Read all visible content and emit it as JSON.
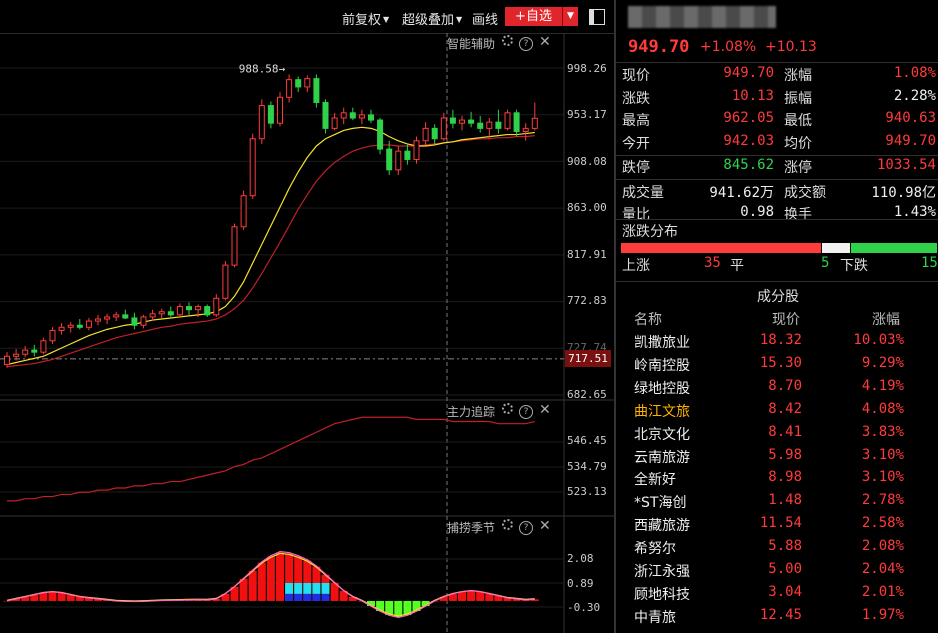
{
  "toolbar": {
    "items": [
      "前复权",
      "超级叠加",
      "画线"
    ],
    "add_fav": "+自选"
  },
  "panels": {
    "main_title": "智能辅助",
    "sub1_title": "主力追踪",
    "sub2_title": "捕捞季节"
  },
  "axis": {
    "main": [
      "998.26",
      "953.17",
      "908.08",
      "863.00",
      "817.91",
      "772.83",
      "727.74",
      "682.65"
    ],
    "price_tag": "717.51",
    "sub1": [
      "546.45",
      "534.79",
      "523.13"
    ],
    "sub2": [
      "2.08",
      "0.89",
      "-0.30"
    ]
  },
  "colors": {
    "up": "#ff3b3b",
    "down": "#2fd24a",
    "ma_fast": "#f5e12a",
    "ma_slow": "#c0202a",
    "brand": "#e0262c"
  },
  "chart_data": {
    "type": "candlestick",
    "peak_label": "988.58→",
    "y_ticks": [
      998.26,
      953.17,
      908.08,
      863.0,
      817.91,
      772.83,
      727.74,
      682.65
    ],
    "current_price_line": 717.51,
    "candles": [
      [
        712,
        724,
        709,
        720
      ],
      [
        720,
        727,
        716,
        722
      ],
      [
        722,
        730,
        719,
        726
      ],
      [
        726,
        731,
        720,
        724
      ],
      [
        724,
        738,
        722,
        735
      ],
      [
        735,
        748,
        732,
        745
      ],
      [
        745,
        752,
        741,
        748
      ],
      [
        748,
        753,
        743,
        750
      ],
      [
        750,
        756,
        746,
        748
      ],
      [
        748,
        757,
        745,
        754
      ],
      [
        754,
        760,
        750,
        756
      ],
      [
        756,
        761,
        751,
        758
      ],
      [
        758,
        763,
        754,
        760
      ],
      [
        760,
        765,
        756,
        757
      ],
      [
        757,
        762,
        746,
        750
      ],
      [
        750,
        760,
        747,
        758
      ],
      [
        758,
        765,
        754,
        761
      ],
      [
        761,
        766,
        757,
        763
      ],
      [
        763,
        768,
        758,
        760
      ],
      [
        760,
        771,
        757,
        768
      ],
      [
        768,
        772,
        760,
        765
      ],
      [
        765,
        770,
        758,
        768
      ],
      [
        768,
        770,
        758,
        760
      ],
      [
        760,
        780,
        758,
        776
      ],
      [
        776,
        812,
        774,
        808
      ],
      [
        808,
        848,
        806,
        845
      ],
      [
        845,
        880,
        842,
        875
      ],
      [
        875,
        935,
        872,
        930
      ],
      [
        930,
        968,
        925,
        962
      ],
      [
        962,
        966,
        940,
        945
      ],
      [
        945,
        975,
        942,
        970
      ],
      [
        970,
        992,
        965,
        987
      ],
      [
        987,
        990,
        975,
        980
      ],
      [
        980,
        991,
        975,
        988
      ],
      [
        988,
        992,
        960,
        965
      ],
      [
        965,
        968,
        935,
        940
      ],
      [
        940,
        955,
        938,
        950
      ],
      [
        950,
        960,
        944,
        955
      ],
      [
        955,
        960,
        948,
        950
      ],
      [
        950,
        958,
        944,
        953
      ],
      [
        953,
        958,
        945,
        948
      ],
      [
        948,
        950,
        915,
        920
      ],
      [
        920,
        928,
        895,
        900
      ],
      [
        900,
        923,
        895,
        918
      ],
      [
        918,
        925,
        905,
        910
      ],
      [
        910,
        932,
        906,
        928
      ],
      [
        928,
        946,
        924,
        940
      ],
      [
        940,
        944,
        925,
        930
      ],
      [
        930,
        955,
        928,
        950
      ],
      [
        950,
        958,
        940,
        945
      ],
      [
        945,
        952,
        938,
        948
      ],
      [
        948,
        956,
        941,
        945
      ],
      [
        945,
        952,
        936,
        940
      ],
      [
        940,
        950,
        930,
        946
      ],
      [
        946,
        958,
        935,
        940
      ],
      [
        940,
        958,
        938,
        955
      ],
      [
        955,
        958,
        932,
        937
      ],
      [
        937,
        945,
        928,
        940
      ],
      [
        940,
        965,
        938,
        949.7
      ]
    ],
    "ma_fast": [
      712,
      714,
      716,
      718,
      720,
      724,
      728,
      732,
      736,
      740,
      743,
      746,
      748,
      750,
      751,
      753,
      755,
      756,
      757,
      758,
      759,
      760,
      761,
      763,
      768,
      778,
      792,
      810,
      828,
      846,
      864,
      882,
      898,
      912,
      923,
      930,
      934,
      938,
      940,
      941,
      940,
      937,
      932,
      928,
      925,
      923,
      923,
      924,
      926,
      927,
      929,
      930,
      931,
      932,
      933,
      934,
      934,
      935,
      936
    ],
    "ma_slow": [
      710,
      711,
      712,
      713,
      715,
      717,
      720,
      723,
      726,
      729,
      732,
      735,
      738,
      740,
      742,
      744,
      746,
      748,
      749,
      751,
      752,
      753,
      754,
      756,
      760,
      766,
      774,
      786,
      800,
      815,
      830,
      846,
      862,
      876,
      889,
      899,
      907,
      913,
      918,
      921,
      923,
      924,
      924,
      923,
      923,
      923,
      924,
      925,
      926,
      927,
      928,
      929,
      930,
      930,
      931,
      931,
      932,
      932,
      933
    ],
    "sub1_line": [
      519,
      519,
      520,
      520,
      521,
      521,
      522,
      522,
      523,
      523,
      524,
      524,
      525,
      525,
      526,
      526,
      527,
      527,
      528,
      528,
      529,
      530,
      531,
      532,
      533,
      535,
      536,
      538,
      539,
      541,
      543,
      545,
      547,
      549,
      551,
      553,
      555,
      556,
      557,
      558,
      558,
      558,
      558,
      558,
      558,
      557,
      557,
      557,
      557,
      556,
      556,
      556,
      556,
      556,
      555,
      555,
      555,
      555,
      556
    ],
    "sub2_values": [
      0.0,
      0.1,
      0.2,
      0.3,
      0.4,
      0.45,
      0.4,
      0.3,
      0.2,
      0.15,
      0.1,
      0.05,
      0.0,
      -0.02,
      -0.03,
      -0.02,
      0.0,
      0.02,
      0.03,
      0.04,
      0.05,
      0.06,
      0.05,
      0.1,
      0.35,
      0.7,
      1.1,
      1.5,
      1.9,
      2.2,
      2.4,
      2.35,
      2.2,
      2.0,
      1.7,
      1.3,
      0.9,
      0.5,
      0.2,
      0.0,
      -0.25,
      -0.5,
      -0.7,
      -0.8,
      -0.7,
      -0.5,
      -0.25,
      0.0,
      0.2,
      0.35,
      0.45,
      0.5,
      0.45,
      0.35,
      0.25,
      0.15,
      0.1,
      0.05,
      0.08
    ]
  },
  "quote": {
    "price": "949.70",
    "chg_pct": "+1.08%",
    "chg_abs": "+10.13",
    "rows": [
      {
        "l": "现价",
        "v": "949.70",
        "vc": "red",
        "l2": "涨幅",
        "v2": "1.08%",
        "v2c": "red"
      },
      {
        "l": "涨跌",
        "v": "10.13",
        "vc": "red",
        "l2": "振幅",
        "v2": "2.28%",
        "v2c": "white"
      },
      {
        "l": "最高",
        "v": "962.05",
        "vc": "red",
        "l2": "最低",
        "v2": "940.63",
        "v2c": "red"
      },
      {
        "l": "今开",
        "v": "942.03",
        "vc": "red",
        "l2": "均价",
        "v2": "949.70",
        "v2c": "red"
      },
      {
        "l": "跌停",
        "v": "845.62",
        "vc": "green",
        "l2": "涨停",
        "v2": "1033.54",
        "v2c": "red"
      },
      {
        "l": "成交量",
        "v": "941.62万",
        "vc": "white",
        "l2": "成交额",
        "v2": "110.98亿",
        "v2c": "white"
      },
      {
        "l": "量比",
        "v": "0.98",
        "vc": "white",
        "l2": "换手",
        "v2": "1.43%",
        "v2c": "white"
      }
    ]
  },
  "distribution": {
    "title": "涨跌分布",
    "up_label": "上涨",
    "up": "35",
    "flat_label": "平",
    "flat": "5",
    "down_label": "下跌",
    "down": "15"
  },
  "components": {
    "title": "成分股",
    "headers": [
      "名称",
      "现价",
      "涨幅"
    ],
    "rows": [
      [
        "凯撒旅业",
        "18.32",
        "10.03%"
      ],
      [
        "岭南控股",
        "15.30",
        "9.29%"
      ],
      [
        "绿地控股",
        "8.70",
        "4.19%"
      ],
      [
        "曲江文旅",
        "8.42",
        "4.08%"
      ],
      [
        "北京文化",
        "8.41",
        "3.83%"
      ],
      [
        "云南旅游",
        "5.98",
        "3.10%"
      ],
      [
        "全新好",
        "8.98",
        "3.10%"
      ],
      [
        "*ST海创",
        "1.48",
        "2.78%"
      ],
      [
        "西藏旅游",
        "11.54",
        "2.58%"
      ],
      [
        "希努尔",
        "5.88",
        "2.08%"
      ],
      [
        "浙江永强",
        "5.00",
        "2.04%"
      ],
      [
        "顾地科技",
        "3.04",
        "2.01%"
      ],
      [
        "中青旅",
        "12.45",
        "1.97%"
      ]
    ]
  }
}
